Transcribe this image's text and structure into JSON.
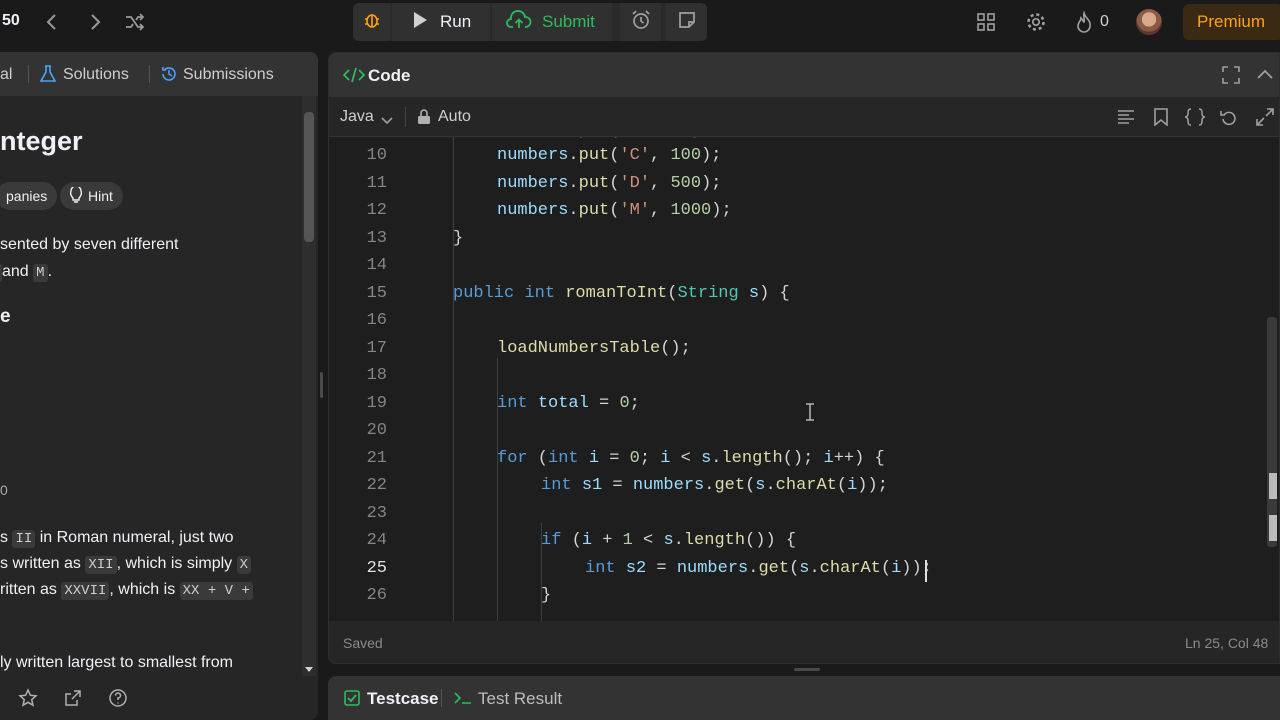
{
  "topbar": {
    "problem_number": "50",
    "run_label": "Run",
    "submit_label": "Submit",
    "streak_count": "0",
    "premium_label": "Premium"
  },
  "left_panel": {
    "tabs": [
      "al",
      "Solutions",
      "Submissions"
    ],
    "title": "nteger",
    "chips": [
      "panies",
      "Hint"
    ],
    "desc_line1": "sented by seven different",
    "desc_line2_mid": "and",
    "desc_line2_code1": "",
    "desc_line2_code2": "M",
    "desc_line2_end": ".",
    "heading_fragment": "e",
    "zero_fragment": "0",
    "ex_line1_pre": "s",
    "ex_line1_code": "II",
    "ex_line1_post": "in Roman numeral, just two",
    "ex_line2_pre": "s written as",
    "ex_line2_code": "XII",
    "ex_line2_post": ", which is simply",
    "ex_line2_code2": "X",
    "ex_line3_pre": "ritten as",
    "ex_line3_code": "XXVII",
    "ex_line3_post": ", which is",
    "ex_line3_code2": "XX + V +",
    "ex_line4": "ly written largest to smallest from"
  },
  "code_panel": {
    "title": "Code",
    "language": "Java",
    "mode": "Auto",
    "status": "Saved",
    "cursor_position": "Ln 25, Col 48"
  },
  "code_lines": [
    {
      "n": "10",
      "text": "numbers.put('C', 100);"
    },
    {
      "n": "11",
      "text": "numbers.put('D', 500);"
    },
    {
      "n": "12",
      "text": "numbers.put('M', 1000);"
    },
    {
      "n": "13",
      "text": "}"
    },
    {
      "n": "14",
      "text": ""
    },
    {
      "n": "15",
      "text": "public int romanToInt(String s) {"
    },
    {
      "n": "16",
      "text": ""
    },
    {
      "n": "17",
      "text": "loadNumbersTable();"
    },
    {
      "n": "18",
      "text": ""
    },
    {
      "n": "19",
      "text": "int total = 0;"
    },
    {
      "n": "20",
      "text": ""
    },
    {
      "n": "21",
      "text": "for (int i = 0; i < s.length(); i++) {"
    },
    {
      "n": "22",
      "text": "int s1 = numbers.get(s.charAt(i));"
    },
    {
      "n": "23",
      "text": ""
    },
    {
      "n": "24",
      "text": "if (i + 1 < s.length()) {"
    },
    {
      "n": "25",
      "text": "int s2 = numbers.get(s.charAt(i));"
    },
    {
      "n": "26",
      "text": "}"
    }
  ],
  "bottom_panel": {
    "testcase_label": "Testcase",
    "result_label": "Test Result"
  },
  "colors": {
    "accent_orange": "#ffa116",
    "submit_green": "#2cbb5d",
    "keyword_blue": "#569cd6"
  }
}
